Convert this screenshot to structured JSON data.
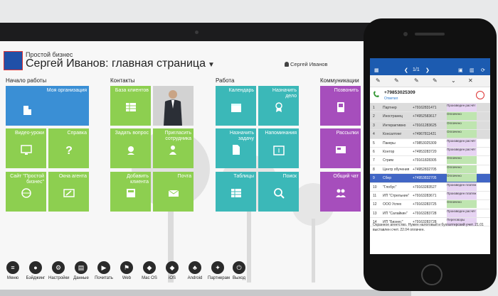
{
  "app": {
    "brand": "Простой бизнес",
    "title": "Сергей Иванов: главная страница",
    "user": "Сергей Иванов"
  },
  "sections": {
    "start": "Начало работы",
    "contacts": "Контакты",
    "work": "Работа",
    "comms": "Коммуникации"
  },
  "tiles": {
    "my_org": "Моя организация",
    "video": "Видео-уроки",
    "help": "Справка",
    "site": "Сайт \"Простой бизнес\"",
    "windows": "Окна агента",
    "contacts_base": "База клиентов",
    "staff": "Пригласить сотрудника",
    "question": "Задать вопрос",
    "add_client": "Добавить клиента",
    "mail": "Почта",
    "calendar": "Календарь",
    "assign": "Назначить дело",
    "assign_task": "Назначить задачу",
    "reminders": "Напоминания",
    "tables": "Таблицы",
    "search": "Поиск",
    "call": "Позвонить",
    "mailing": "Рассылки",
    "chat": "Общий чат"
  },
  "dock": [
    "Меню",
    "Бэйджинг",
    "Настройки",
    "Данные",
    "Почитать",
    "Web",
    "Mac OS",
    "iOS",
    "Android",
    "Партнерам",
    "Выход"
  ],
  "phone": {
    "nav_page": "1/1",
    "call_number": "+79853025309",
    "call_status": "Ответил",
    "rows": [
      {
        "n": "1",
        "name": "Партнер",
        "phone": "+79162831471",
        "status": "Произведен расчёт"
      },
      {
        "n": "2",
        "name": "Иностранец",
        "phone": "+74952583617",
        "status": "Оплачено"
      },
      {
        "n": "3",
        "name": "Интерактивно",
        "phone": "+79161283625",
        "status": "Оплачено"
      },
      {
        "n": "4",
        "name": "Консалтинг",
        "phone": "+74967811421",
        "status": "Оплачено"
      },
      {
        "n": "5",
        "name": "Пакеры",
        "phone": "+79853025309",
        "status": "Произведен расчёт"
      },
      {
        "n": "6",
        "name": "Контор",
        "phone": "+74953283720",
        "status": "Произведен расчёт"
      },
      {
        "n": "7",
        "name": "Стрим",
        "phone": "+79161828305",
        "status": "Оплачено"
      },
      {
        "n": "8",
        "name": "Центр обучения",
        "phone": "+74952832705",
        "status": "Оплачено"
      },
      {
        "n": "9",
        "name": "Сбер",
        "phone": "+74953832705",
        "status": "Оплачено"
      },
      {
        "n": "10",
        "name": "\"Глобус\"",
        "phone": "+79163283527",
        "status": "Произведен платеж"
      },
      {
        "n": "11",
        "name": "ИП \"Стрельнин\"",
        "phone": "+79163283671",
        "status": "Произведен платеж"
      },
      {
        "n": "12",
        "name": "ООО Успех",
        "phone": "+79163283725",
        "status": "Оплачено"
      },
      {
        "n": "13",
        "name": "ИП \"Салайкин\"",
        "phone": "+79163283728",
        "status": "Произведен расчёт"
      },
      {
        "n": "14",
        "name": "ИП \"Бизнес\"",
        "phone": "+79163283728",
        "status": "Переговоры"
      }
    ],
    "note": "Охранное агентство. Нужен налоговый и бухгалтерский учет. 21.01 выставлен счет. 22.04 оплачен."
  },
  "colors": {
    "blue": "#3a8fd5",
    "green": "#8dcf50",
    "teal": "#3bb8b8",
    "purple": "#a64ebc",
    "phone_bar": "#1c5bb0"
  }
}
